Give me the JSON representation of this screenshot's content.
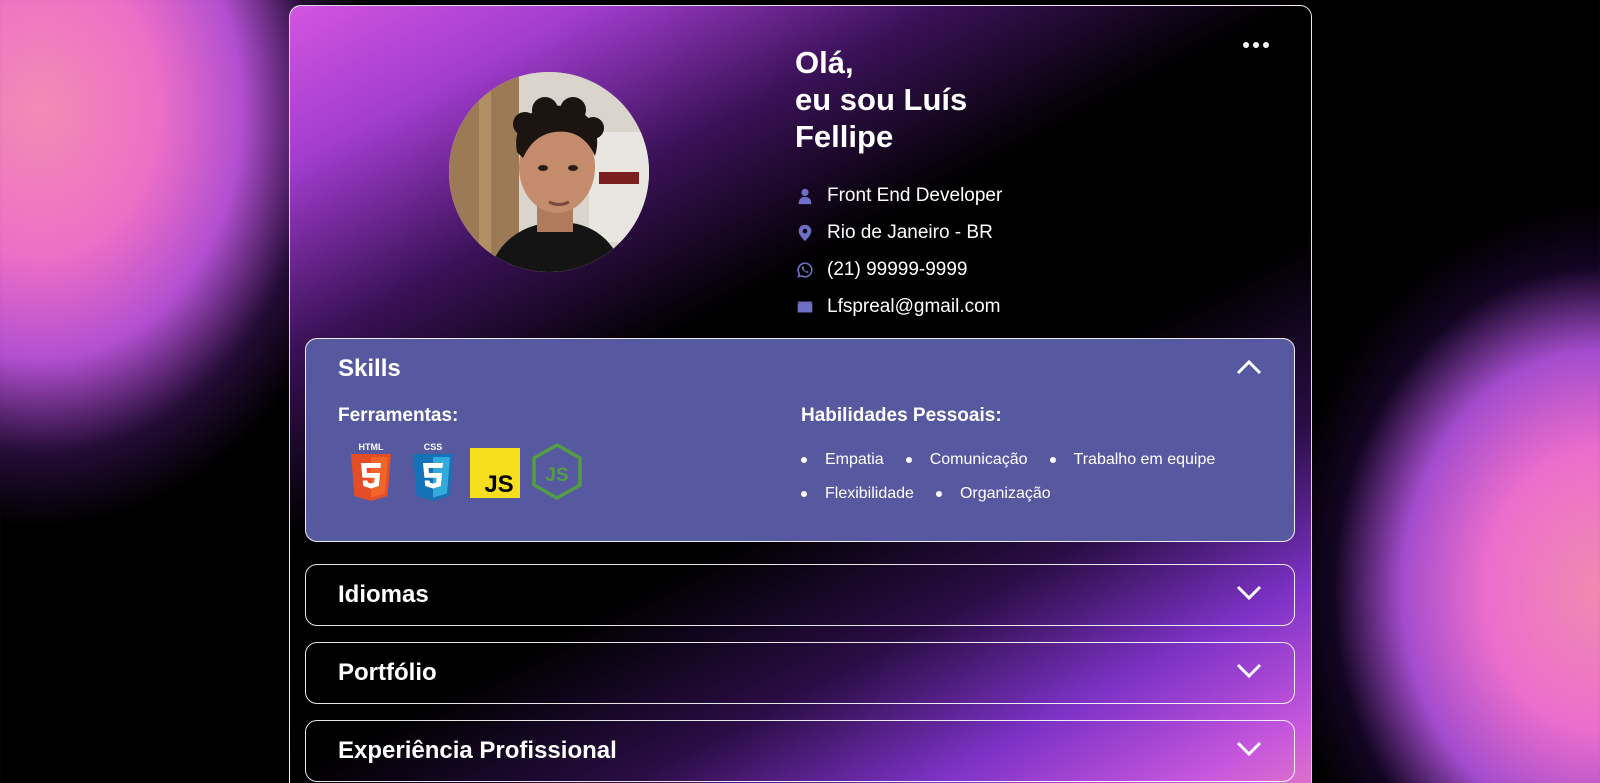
{
  "profile": {
    "greeting_line1": "Olá,",
    "greeting_line2": "eu sou Luís",
    "greeting_line3": "Fellipe",
    "contacts": [
      {
        "icon": "user-icon",
        "text": "Front End Developer"
      },
      {
        "icon": "location-pin-icon",
        "text": "Rio de Janeiro - BR"
      },
      {
        "icon": "whatsapp-icon",
        "text": "(21) 99999-9999"
      },
      {
        "icon": "envelope-icon",
        "text": "Lfspreal@gmail.com"
      }
    ]
  },
  "skills": {
    "title": "Skills",
    "tools_title": "Ferramentas:",
    "tools": [
      {
        "icon": "html5-icon",
        "label": "HTML"
      },
      {
        "icon": "css3-icon",
        "label": "CSS"
      },
      {
        "icon": "javascript-icon",
        "label": "JS"
      },
      {
        "icon": "nodejs-icon",
        "label": "JS"
      }
    ],
    "soft_title": "Habilidades Pessoais:",
    "soft_skills": [
      "Empatia",
      "Comunicação",
      "Trabalho em equipe",
      "Flexibilidade",
      "Organização"
    ]
  },
  "sections": {
    "idiomas": "Idiomas",
    "portfolio": "Portfólio",
    "experiencia": "Experiência Profissional"
  },
  "colors": {
    "skills_panel": "#5759a0",
    "contact_icon": "#6e6fc7",
    "gradient_pink": "#e274c9",
    "gradient_purple": "#a23dcf"
  }
}
